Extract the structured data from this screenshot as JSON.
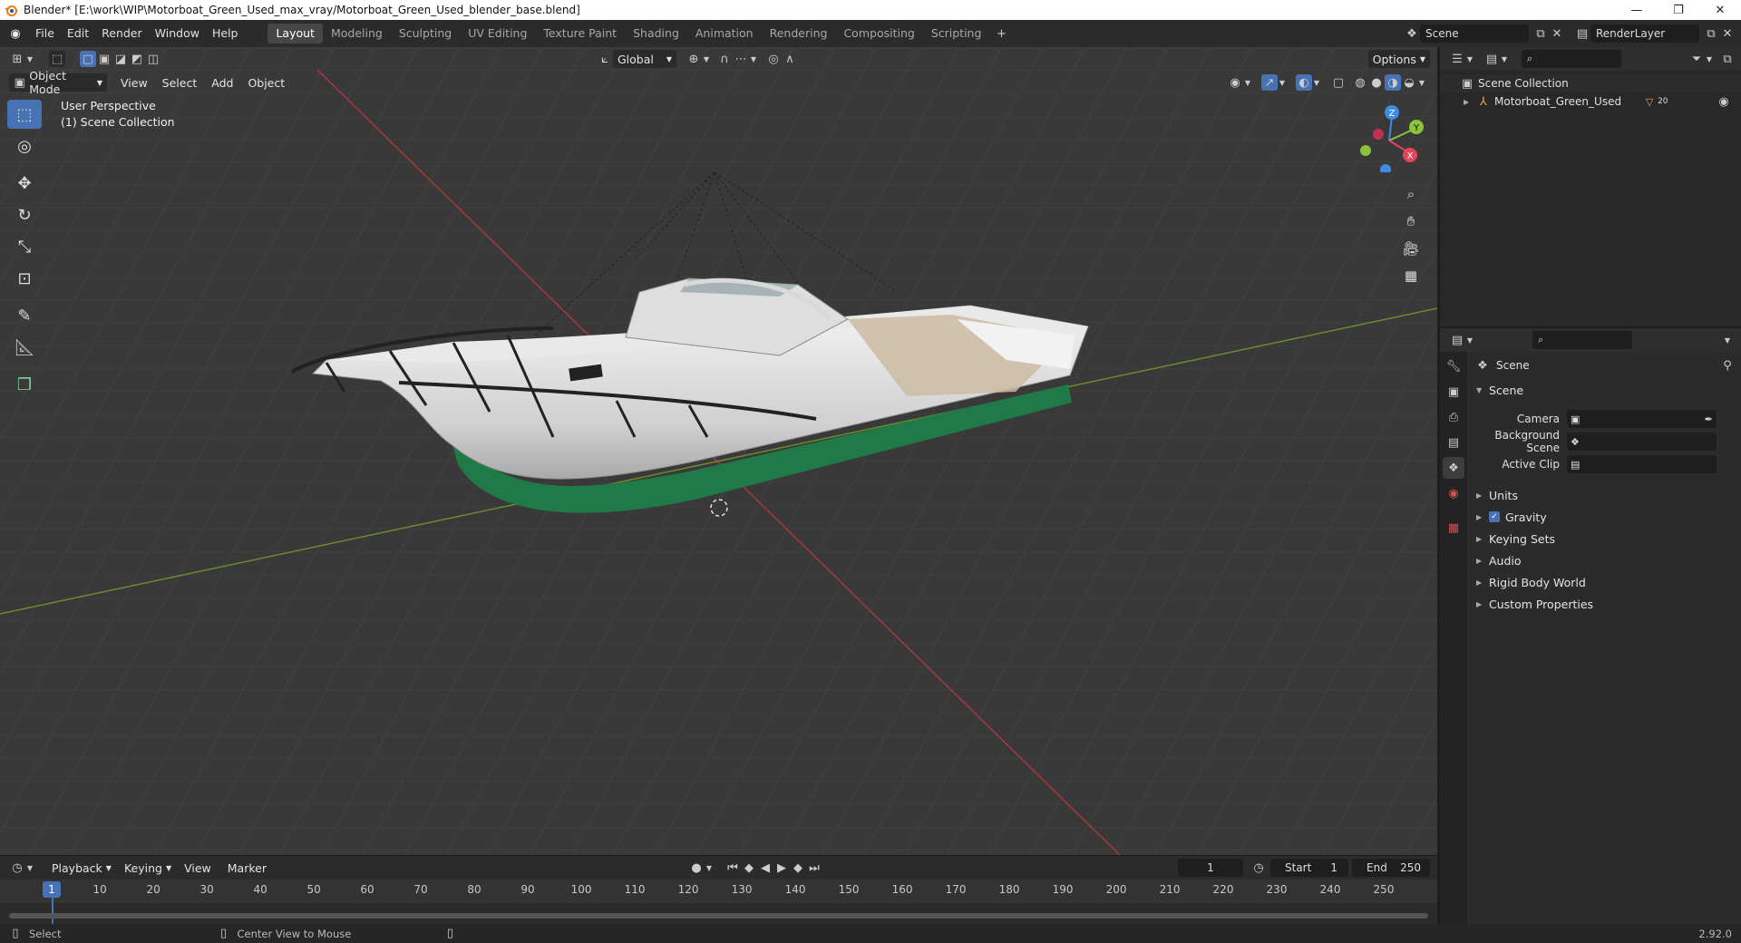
{
  "window": {
    "title": "Blender* [E:\\work\\WIP\\Motorboat_Green_Used_max_vray/Motorboat_Green_Used_blender_base.blend]",
    "minimize": "—",
    "maximize": "❐",
    "close": "✕"
  },
  "menu": [
    "File",
    "Edit",
    "Render",
    "Window",
    "Help"
  ],
  "workspaces": [
    "Layout",
    "Modeling",
    "Sculpting",
    "UV Editing",
    "Texture Paint",
    "Shading",
    "Animation",
    "Rendering",
    "Compositing",
    "Scripting"
  ],
  "scene_selector": {
    "value": "Scene"
  },
  "viewlayer_selector": {
    "value": "RenderLayer"
  },
  "viewport": {
    "transform_orientation": "Global",
    "options_label": "Options",
    "mode": "Object Mode",
    "menus": [
      "View",
      "Select",
      "Add",
      "Object"
    ],
    "overlay_perspective": "User Perspective",
    "overlay_collection": "(1) Scene Collection",
    "gizmo": {
      "z": "Z",
      "y": "Y",
      "x": "X"
    }
  },
  "timeline": {
    "menus": [
      "Playback",
      "Keying",
      "View",
      "Marker"
    ],
    "current_frame": "1",
    "start_label": "Start",
    "start_value": "1",
    "end_label": "End",
    "end_value": "250",
    "ticks": [
      "1",
      "10",
      "20",
      "30",
      "40",
      "50",
      "60",
      "70",
      "80",
      "90",
      "100",
      "110",
      "120",
      "130",
      "140",
      "150",
      "160",
      "170",
      "180",
      "190",
      "200",
      "210",
      "220",
      "230",
      "240",
      "250"
    ]
  },
  "statusbar": {
    "select": "Select",
    "center_view": "Center View to Mouse",
    "version": "2.92.0"
  },
  "outliner": {
    "root": "Scene Collection",
    "items": [
      {
        "name": "Motorboat_Green_Used",
        "badge": "20"
      }
    ]
  },
  "properties": {
    "context": "Scene",
    "panel": "Scene",
    "fields": [
      {
        "label": "Camera",
        "value": ""
      },
      {
        "label": "Background Scene",
        "value": ""
      },
      {
        "label": "Active Clip",
        "value": ""
      }
    ],
    "subpanels": [
      "Units",
      "Gravity",
      "Keying Sets",
      "Audio",
      "Rigid Body World",
      "Custom Properties"
    ]
  },
  "colors": {
    "accent": "#4772b3",
    "x_axis": "#e8445a",
    "y_axis": "#8bc33a",
    "z_axis": "#3f8be8",
    "hull_stripe": "#1f7a47"
  }
}
